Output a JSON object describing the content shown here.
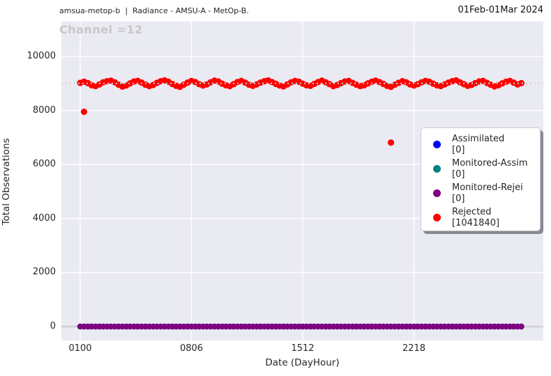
{
  "header": {
    "title_left": "amsua-metop-b  |  Radiance - AMSU-A - MetOp-B.",
    "title_right": "01Feb-01Mar 2024"
  },
  "colors": {
    "plot_bg": "#eaeaf2",
    "grid": "#ffffff",
    "ref_line": "#cfcfd4",
    "channel_label": "#c8c8c8",
    "assimilated": "#0000ff",
    "monitored_assim": "#008080",
    "monitored_rejei": "#800080",
    "rejected": "#ff0000"
  },
  "legend": {
    "items": [
      {
        "name": "Assimilated",
        "count_label": "[0]",
        "color": "#0000ff"
      },
      {
        "name": "Monitored-Assim",
        "count_label": "[0]",
        "color": "#008080"
      },
      {
        "name": "Monitored-Rejei",
        "count_label": "[0]",
        "color": "#800080"
      },
      {
        "name": "Rejected",
        "count_label": "[1041840]",
        "color": "#ff0000"
      }
    ]
  },
  "chart_data": {
    "type": "scatter",
    "annotation": "Channel =12",
    "xlabel": "Date (DayHour)",
    "ylabel": "Total Observations",
    "x_ticks": [
      {
        "hour": 0,
        "label": "0100"
      },
      {
        "hour": 174,
        "label": "0806"
      },
      {
        "hour": 348,
        "label": "1512"
      },
      {
        "hour": 522,
        "label": "2218"
      }
    ],
    "y_ticks": [
      {
        "value": 0,
        "label": "0"
      },
      {
        "value": 2000,
        "label": "2000"
      },
      {
        "value": 4000,
        "label": "4000"
      },
      {
        "value": 6000,
        "label": "6000"
      },
      {
        "value": 8000,
        "label": "8000"
      },
      {
        "value": 10000,
        "label": "10000"
      }
    ],
    "xlim_hours": [
      -30,
      724
    ],
    "ylim": [
      -515,
      11290
    ],
    "grid": true,
    "legend_position": "center-right",
    "ref_lines": [
      {
        "value": 9000,
        "style": "dotted"
      },
      {
        "value": 0,
        "style": "solid"
      }
    ],
    "hours": [
      0,
      6,
      12,
      18,
      24,
      30,
      36,
      42,
      48,
      54,
      60,
      66,
      72,
      78,
      84,
      90,
      96,
      102,
      108,
      114,
      120,
      126,
      132,
      138,
      144,
      150,
      156,
      162,
      168,
      174,
      180,
      186,
      192,
      198,
      204,
      210,
      216,
      222,
      228,
      234,
      240,
      246,
      252,
      258,
      264,
      270,
      276,
      282,
      288,
      294,
      300,
      306,
      312,
      318,
      324,
      330,
      336,
      342,
      348,
      354,
      360,
      366,
      372,
      378,
      384,
      390,
      396,
      402,
      408,
      414,
      420,
      426,
      432,
      438,
      444,
      450,
      456,
      462,
      468,
      474,
      480,
      486,
      492,
      498,
      504,
      510,
      516,
      522,
      528,
      534,
      540,
      546,
      552,
      558,
      564,
      570,
      576,
      582,
      588,
      594,
      600,
      606,
      612,
      618,
      624,
      630,
      636,
      642,
      648,
      654,
      660,
      666,
      672,
      678,
      684,
      690
    ],
    "series": [
      {
        "name": "Assimilated",
        "color": "#0000ff",
        "constant_value": 0
      },
      {
        "name": "Monitored-Assim",
        "color": "#008080",
        "constant_value": 0
      },
      {
        "name": "Monitored-Rejei",
        "color": "#800080",
        "constant_value": 0
      },
      {
        "name": "Rejected",
        "color": "#ff0000",
        "values": [
          9020,
          9060,
          9010,
          8930,
          8900,
          8960,
          9040,
          9080,
          9100,
          9040,
          8950,
          8880,
          8920,
          9000,
          9070,
          9090,
          9030,
          8950,
          8900,
          8940,
          9020,
          9080,
          9110,
          9060,
          8980,
          8910,
          8870,
          8950,
          9030,
          9090,
          9050,
          8970,
          8920,
          8960,
          9040,
          9100,
          9070,
          8990,
          8930,
          8900,
          8970,
          9050,
          9090,
          9030,
          8950,
          8910,
          8960,
          9030,
          9080,
          9110,
          9050,
          8980,
          8920,
          8890,
          8960,
          9040,
          9090,
          9060,
          8990,
          8930,
          8910,
          8980,
          9050,
          9100,
          9040,
          8970,
          8900,
          8940,
          9010,
          9070,
          9090,
          9020,
          8950,
          8900,
          8930,
          9000,
          9060,
          9100,
          9050,
          8980,
          8910,
          8870,
          8950,
          9020,
          9080,
          9040,
          8960,
          8920,
          8970,
          9040,
          9090,
          9060,
          8990,
          8930,
          8900,
          8960,
          9030,
          9080,
          9110,
          9040,
          8970,
          8910,
          8940,
          9010,
          9070,
          9090,
          9020,
          8950,
          8890,
          8930,
          9000,
          9060,
          9090,
          9030,
          8960,
          9010
        ],
        "extra_points": [
          [
            6,
            7950
          ],
          [
            486,
            6810
          ]
        ]
      }
    ]
  }
}
